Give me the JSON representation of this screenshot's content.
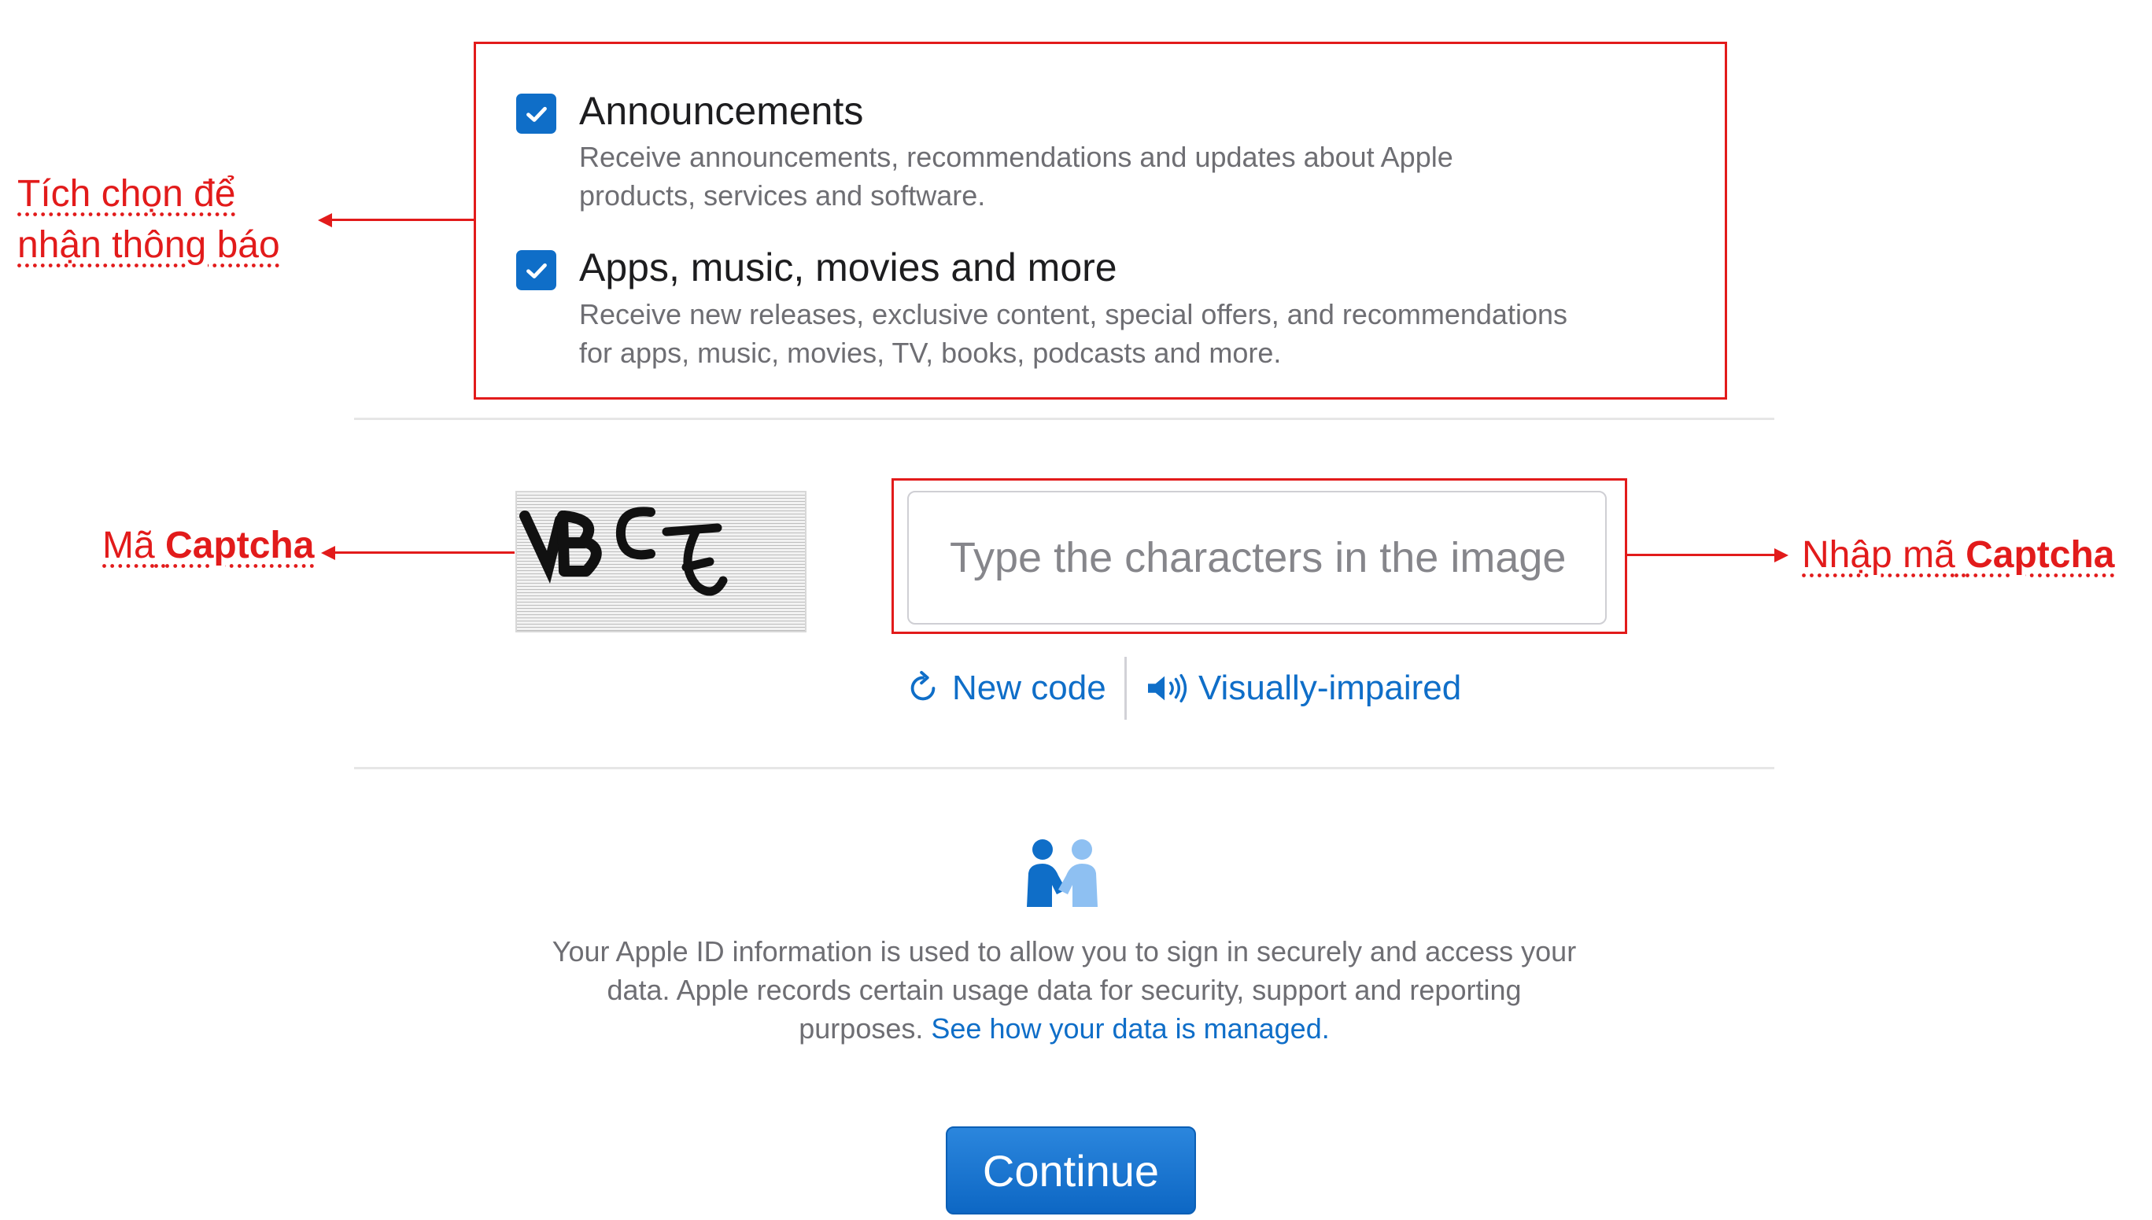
{
  "options": [
    {
      "title": "Announcements",
      "desc_line1": "Receive announcements, recommendations and updates about Apple",
      "desc_line2": "products, services and software.",
      "checked": true
    },
    {
      "title": "Apps, music, movies and more",
      "desc_line1": "Receive new releases, exclusive content, special offers, and recommendations",
      "desc_line2": "for apps, music, movies, TV, books, podcasts and more.",
      "checked": true
    }
  ],
  "annotations": {
    "checkbox_note_line1": "Tích chọn để",
    "checkbox_note_line2": "nhận thông báo",
    "captcha_note_prefix": "Mã",
    "captcha_note_bold": "Captcha",
    "input_note_prefix": "Nhập mã",
    "input_note_bold": "Captcha"
  },
  "captcha": {
    "image_text": "VBCJ",
    "input_placeholder": "Type the characters in the image",
    "new_code_label": "New code",
    "visually_impaired_label": "Visually-impaired"
  },
  "info": {
    "line1": "Your Apple ID information is used to allow you to sign in securely and access your",
    "line2": "data. Apple records certain usage data for security, support and reporting",
    "line3_text": "purposes.",
    "line3_link": "See how your data is managed."
  },
  "continue_label": "Continue",
  "colors": {
    "accent": "#0f6ec8",
    "annotation": "#e21b1b",
    "secondary_text": "#6e6e73"
  }
}
